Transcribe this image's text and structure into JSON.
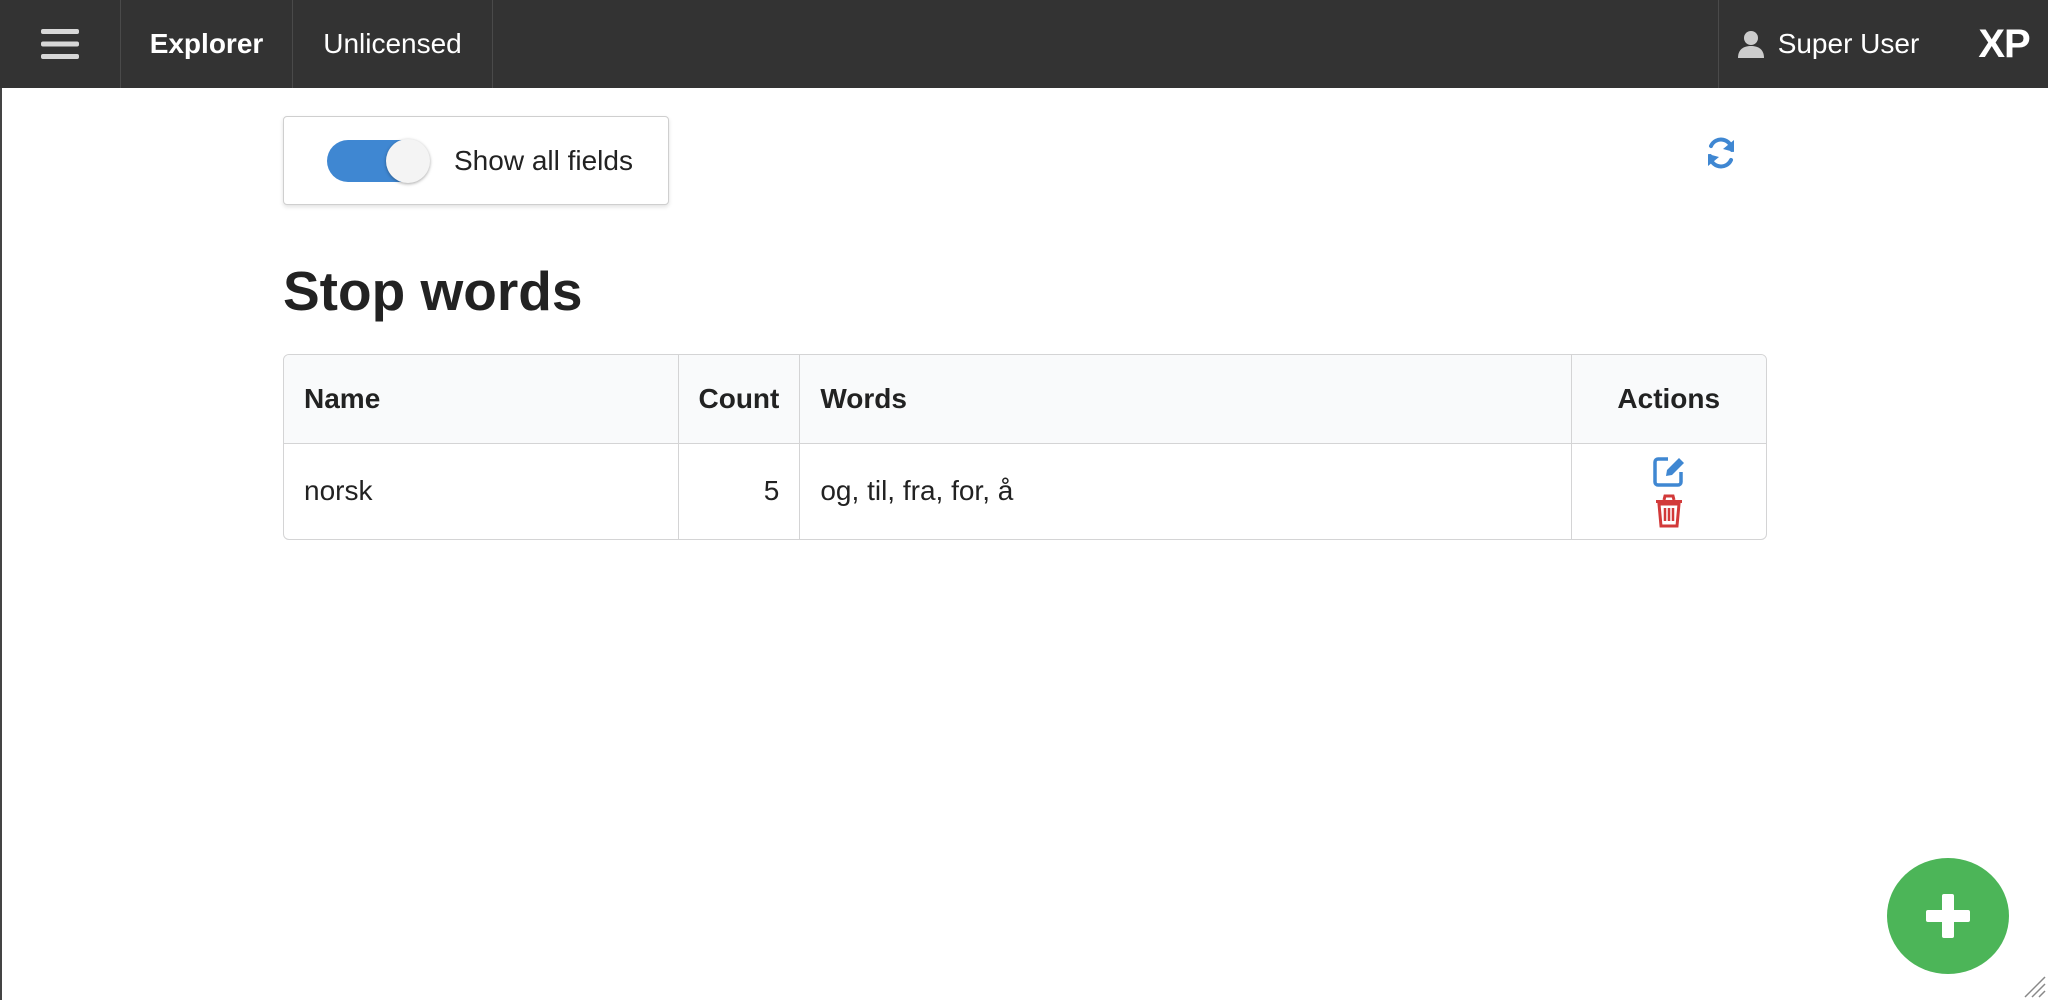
{
  "topbar": {
    "nav_explorer": "Explorer",
    "nav_unlicensed": "Unlicensed",
    "user_name": "Super User",
    "logo": "XP"
  },
  "toolbar": {
    "toggle_label": "Show all fields",
    "toggle_on": true
  },
  "main": {
    "title": "Stop words",
    "table": {
      "headers": {
        "name": "Name",
        "count": "Count",
        "words": "Words",
        "actions": "Actions"
      },
      "rows": [
        {
          "name": "norsk",
          "count": "5",
          "words": "og, til, fra, for, å"
        }
      ]
    }
  },
  "icons": {
    "menu": "hamburger-icon",
    "user": "user-icon",
    "refresh": "refresh-icon",
    "edit": "edit-icon",
    "delete": "trash-icon",
    "add": "plus-icon"
  },
  "colors": {
    "topbar_bg": "#333333",
    "accent_blue": "#3f87d2",
    "delete_red": "#d23a3a",
    "fab_green": "#4cb558"
  }
}
